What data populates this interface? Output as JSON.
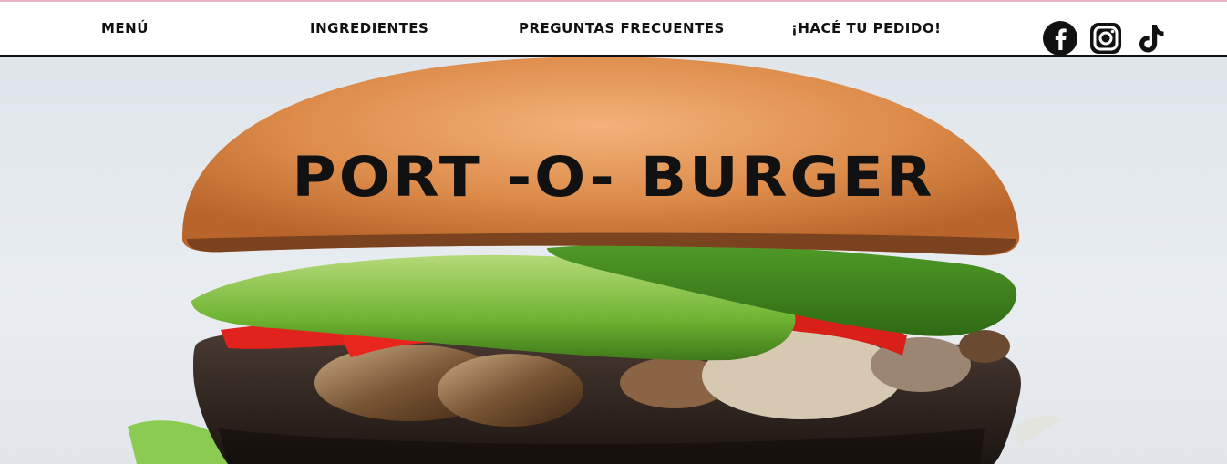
{
  "nav": {
    "items": [
      {
        "label": "MENÚ"
      },
      {
        "label": "INGREDIENTES"
      },
      {
        "label": "PREGUNTAS FRECUENTES"
      },
      {
        "label": "¡HACÉ TU PEDIDO!"
      }
    ],
    "social": [
      {
        "icon": "facebook-icon"
      },
      {
        "icon": "instagram-icon"
      },
      {
        "icon": "tiktok-icon"
      }
    ]
  },
  "hero": {
    "title": "PORT -O- BURGER"
  },
  "colors": {
    "topline": "#e8b4c8",
    "text": "#111111",
    "bun": "#d98a4a",
    "avocado": "#7bbd3c",
    "pepper": "#e0231c"
  }
}
